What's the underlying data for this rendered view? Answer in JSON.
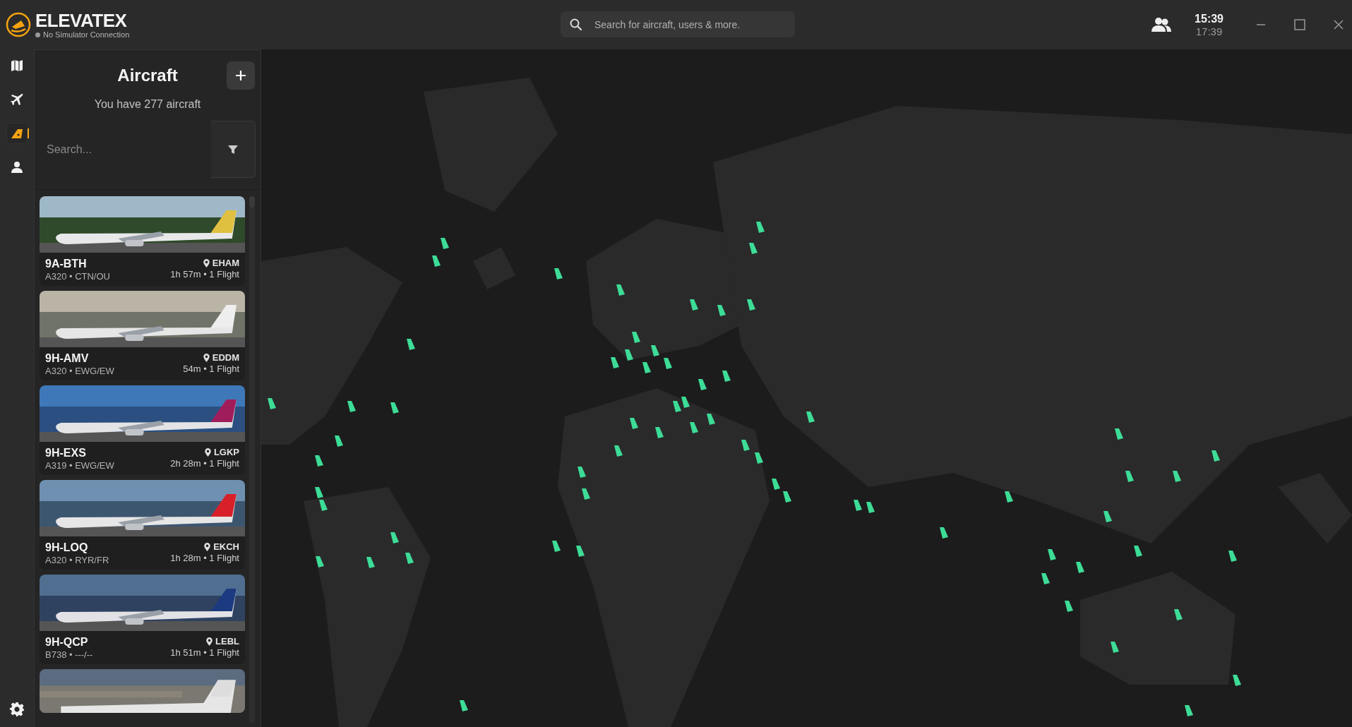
{
  "app": {
    "name": "ELEVATEX",
    "status": "No Simulator Connection",
    "connected": false
  },
  "nav": [
    {
      "kind": "map",
      "selected": false
    },
    {
      "kind": "flights",
      "selected": false
    },
    {
      "kind": "aircraft",
      "selected": true
    },
    {
      "kind": "profile",
      "selected": false
    }
  ],
  "global_search": {
    "placeholder": "Search for aircraft, users & more."
  },
  "clock": {
    "local": "15:39",
    "utc": "17:39"
  },
  "panel": {
    "title": "Aircraft",
    "subtitle": "You have 277 aircraft",
    "search": {
      "placeholder": "Search..."
    }
  },
  "aircraft": [
    {
      "registration": "9A-BTH",
      "type_operator": "A320 • CTN/OU",
      "location": "EHAM",
      "stats": "1h 57m • 1 Flight"
    },
    {
      "registration": "9H-AMV",
      "type_operator": "A320 • EWG/EW",
      "location": "EDDM",
      "stats": "54m • 1 Flight"
    },
    {
      "registration": "9H-EXS",
      "type_operator": "A319 • EWG/EW",
      "location": "LGKP",
      "stats": "2h 28m • 1 Flight"
    },
    {
      "registration": "9H-LOQ",
      "type_operator": "A320 • RYR/FR",
      "location": "EKCH",
      "stats": "1h 28m • 1 Flight"
    },
    {
      "registration": "9H-QCP",
      "type_operator": "B738 • ---/--",
      "location": "LEBL",
      "stats": "1h 51m • 1 Flight"
    }
  ]
}
